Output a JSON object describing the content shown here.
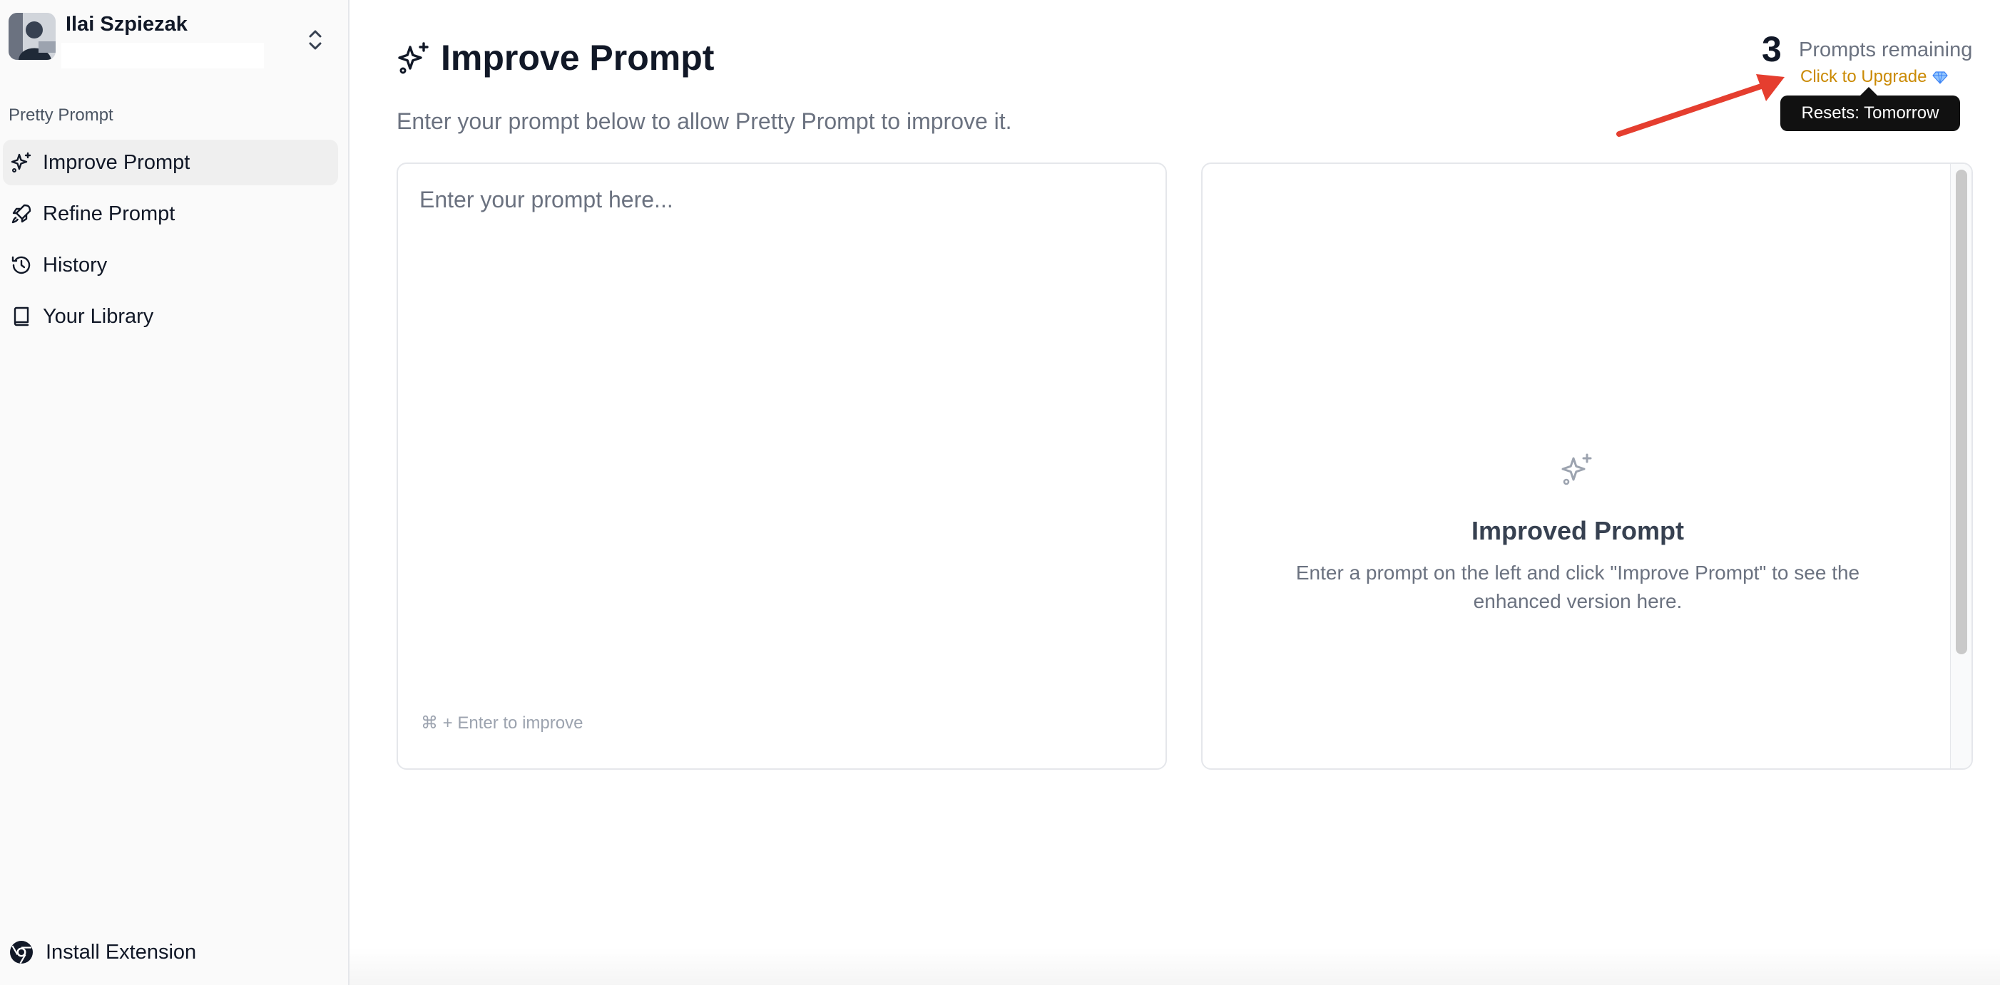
{
  "user": {
    "name": "Ilai Szpiezak",
    "email": ""
  },
  "sidebar": {
    "group_label": "Pretty Prompt",
    "items": [
      {
        "label": "Improve Prompt",
        "icon": "sparkles-icon",
        "active": true
      },
      {
        "label": "Refine Prompt",
        "icon": "rocket-icon",
        "active": false
      },
      {
        "label": "History",
        "icon": "history-icon",
        "active": false
      },
      {
        "label": "Your Library",
        "icon": "book-icon",
        "active": false
      }
    ],
    "install_label": "Install Extension"
  },
  "header": {
    "title": "Improve Prompt",
    "subtitle": "Enter your prompt below to allow Pretty Prompt to improve it."
  },
  "quota": {
    "count": "3",
    "label": "Prompts remaining",
    "upgrade_label": "Click to Upgrade",
    "tooltip": "Resets: Tomorrow"
  },
  "editor": {
    "placeholder": "Enter your prompt here...",
    "value": "",
    "hint": "⌘ + Enter to improve"
  },
  "output": {
    "title": "Improved Prompt",
    "description": "Enter a prompt on the left and click \"Improve Prompt\" to see the enhanced version here."
  },
  "colors": {
    "accent_upgrade": "#ca8a04",
    "annotation_arrow": "#e53e2f",
    "tooltip_bg": "#111111"
  }
}
